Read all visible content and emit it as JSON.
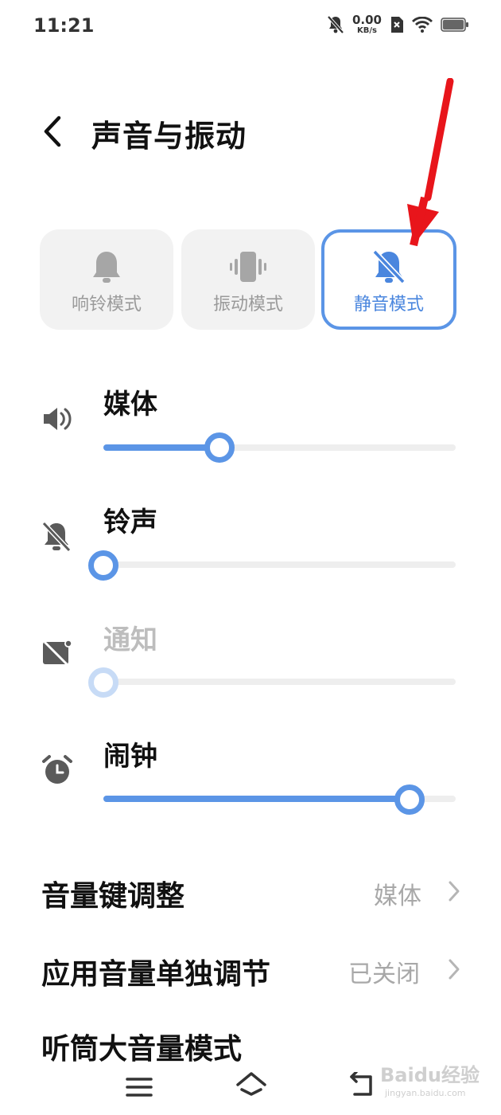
{
  "status_bar": {
    "time": "11:21",
    "net_speed_value": "0.00",
    "net_speed_unit": "KB/s"
  },
  "header": {
    "title": "声音与振动"
  },
  "modes": [
    {
      "label": "响铃模式",
      "icon": "bell-icon",
      "selected": false
    },
    {
      "label": "振动模式",
      "icon": "vibrate-icon",
      "selected": false
    },
    {
      "label": "静音模式",
      "icon": "bell-off-icon",
      "selected": true
    }
  ],
  "volumes": [
    {
      "label": "媒体",
      "icon": "speaker-icon",
      "level": 0.33,
      "enabled": true
    },
    {
      "label": "铃声",
      "icon": "bell-off-icon",
      "level": 0.0,
      "enabled": true
    },
    {
      "label": "通知",
      "icon": "notification-off-icon",
      "level": 0.0,
      "enabled": false
    },
    {
      "label": "闹钟",
      "icon": "alarm-clock-icon",
      "level": 0.87,
      "enabled": true
    }
  ],
  "settings": [
    {
      "title": "音量键调整",
      "value": "媒体"
    },
    {
      "title": "应用音量单独调节",
      "value": "已关闭"
    },
    {
      "title": "听筒大音量模式",
      "value": ""
    }
  ],
  "colors": {
    "accent": "#5b95e6",
    "arrow": "#e8151b"
  },
  "watermark": {
    "brand": "Baidu经验",
    "url": "jingyan.baidu.com"
  }
}
